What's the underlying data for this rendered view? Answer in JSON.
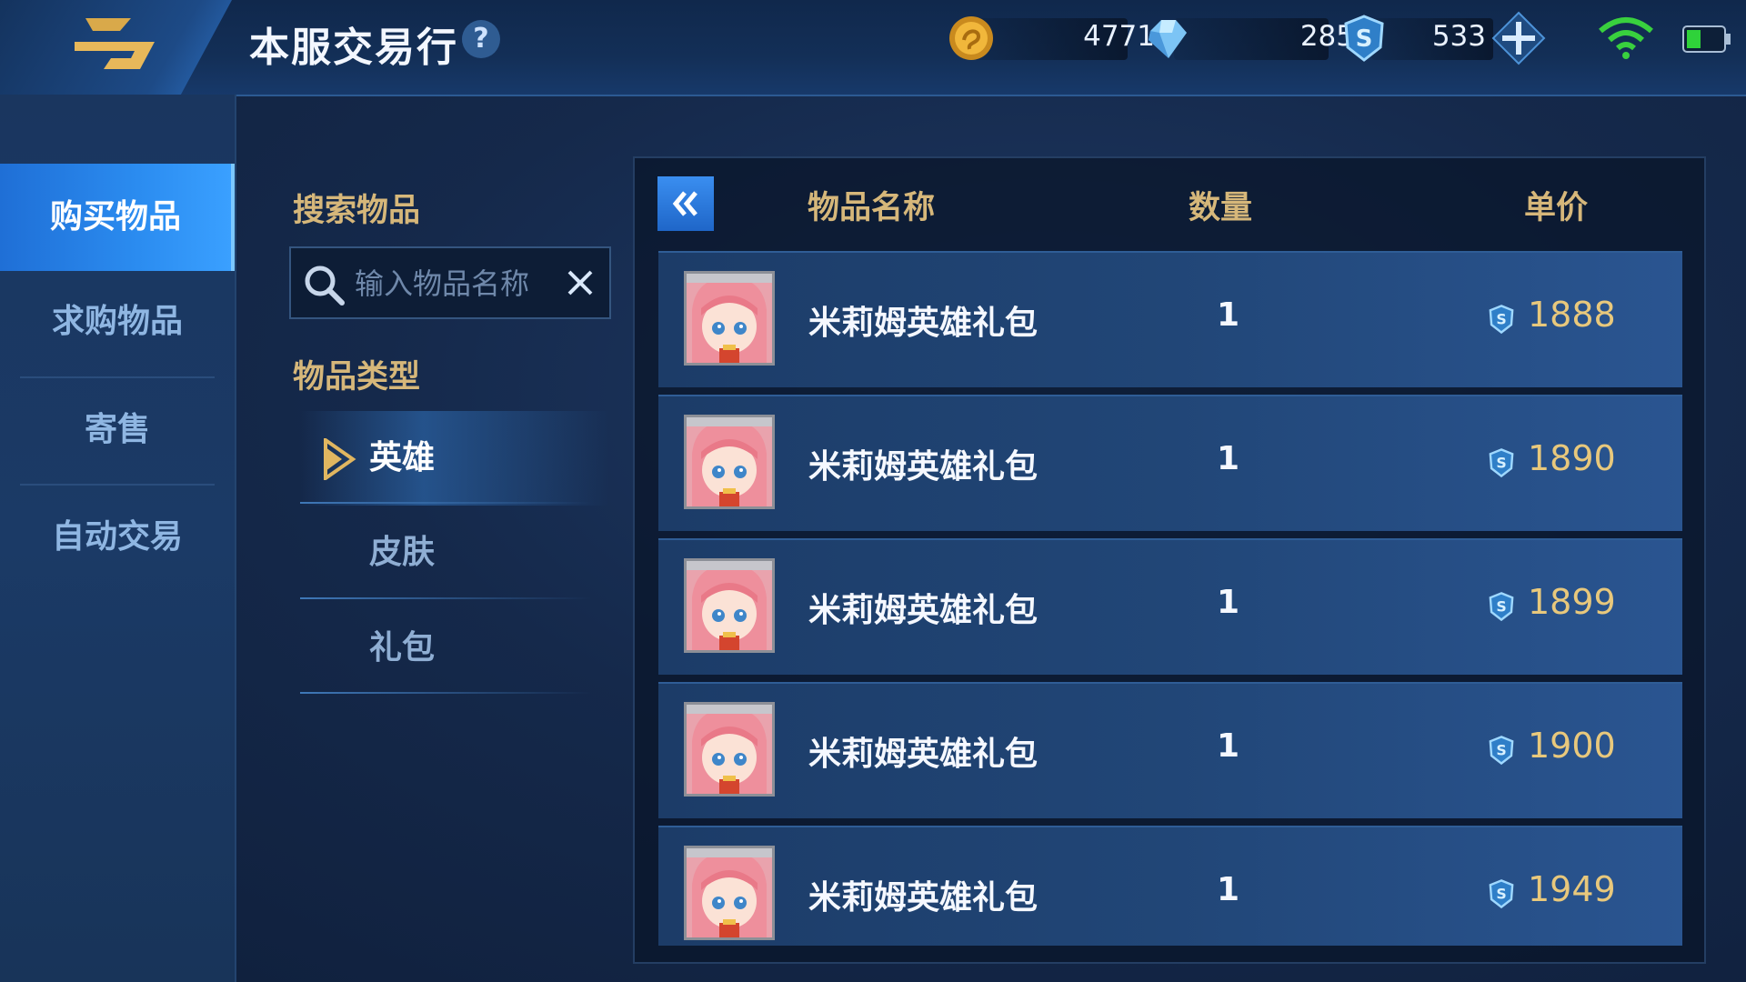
{
  "header": {
    "title": "本服交易行",
    "help": "?",
    "currencies": [
      {
        "icon": "gold-coin-icon",
        "amount": "4771"
      },
      {
        "icon": "diamond-icon",
        "amount": "285"
      },
      {
        "icon": "coupon-icon",
        "amount": "533"
      }
    ]
  },
  "nav": {
    "items": [
      {
        "label": "购买物品",
        "active": true
      },
      {
        "label": "求购物品"
      },
      {
        "label": "寄售"
      },
      {
        "label": "自动交易"
      }
    ]
  },
  "filter": {
    "search_label": "搜索物品",
    "search_placeholder": "输入物品名称",
    "type_label": "物品类型",
    "types": [
      {
        "label": "英雄",
        "active": true
      },
      {
        "label": "皮肤"
      },
      {
        "label": "礼包"
      }
    ]
  },
  "table": {
    "headers": {
      "name": "物品名称",
      "qty": "数量",
      "price": "单价"
    },
    "rows": [
      {
        "name": "米莉姆英雄礼包",
        "qty": "1",
        "price": "1888"
      },
      {
        "name": "米莉姆英雄礼包",
        "qty": "1",
        "price": "1890"
      },
      {
        "name": "米莉姆英雄礼包",
        "qty": "1",
        "price": "1899"
      },
      {
        "name": "米莉姆英雄礼包",
        "qty": "1",
        "price": "1900"
      },
      {
        "name": "米莉姆英雄礼包",
        "qty": "1",
        "price": "1949"
      }
    ]
  },
  "colors": {
    "accent": "#2b8cf0",
    "gold_text": "#d6b77a",
    "price": "#e8c87c"
  },
  "status": {
    "battery_level": 0.4
  }
}
